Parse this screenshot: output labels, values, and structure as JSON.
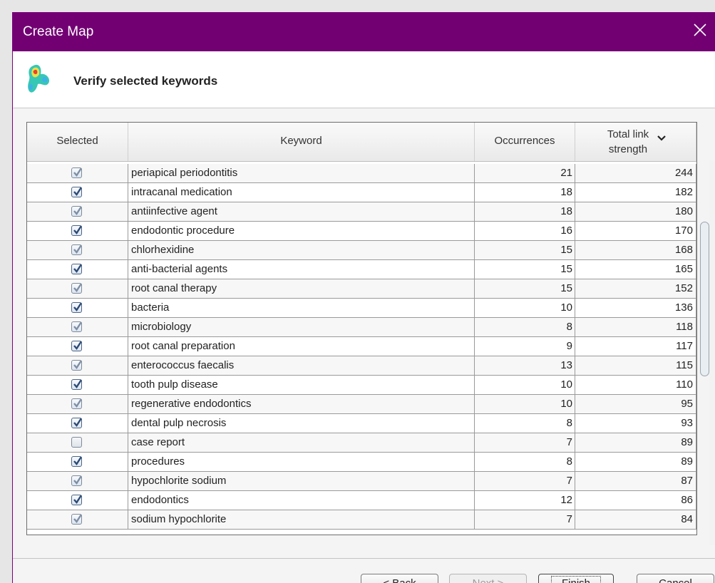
{
  "window": {
    "title": "Create Map"
  },
  "header": {
    "heading": "Verify selected keywords"
  },
  "table": {
    "columns": [
      "Selected",
      "Keyword",
      "Occurrences",
      "Total link strength"
    ],
    "rows": [
      {
        "selected": true,
        "keyword": "periapical periodontitis",
        "occurrences": "21",
        "strength": "244"
      },
      {
        "selected": true,
        "keyword": "intracanal medication",
        "occurrences": "18",
        "strength": "182"
      },
      {
        "selected": true,
        "keyword": "antiinfective agent",
        "occurrences": "18",
        "strength": "180"
      },
      {
        "selected": true,
        "keyword": "endodontic procedure",
        "occurrences": "16",
        "strength": "170"
      },
      {
        "selected": true,
        "keyword": "chlorhexidine",
        "occurrences": "15",
        "strength": "168"
      },
      {
        "selected": true,
        "keyword": "anti-bacterial agents",
        "occurrences": "15",
        "strength": "165"
      },
      {
        "selected": true,
        "keyword": "root canal therapy",
        "occurrences": "15",
        "strength": "152"
      },
      {
        "selected": true,
        "keyword": "bacteria",
        "occurrences": "10",
        "strength": "136"
      },
      {
        "selected": true,
        "keyword": "microbiology",
        "occurrences": "8",
        "strength": "118"
      },
      {
        "selected": true,
        "keyword": "root canal preparation",
        "occurrences": "9",
        "strength": "117"
      },
      {
        "selected": true,
        "keyword": "enterococcus faecalis",
        "occurrences": "13",
        "strength": "115"
      },
      {
        "selected": true,
        "keyword": "tooth pulp disease",
        "occurrences": "10",
        "strength": "110"
      },
      {
        "selected": true,
        "keyword": "regenerative endodontics",
        "occurrences": "10",
        "strength": "95"
      },
      {
        "selected": true,
        "keyword": "dental pulp necrosis",
        "occurrences": "8",
        "strength": "93"
      },
      {
        "selected": false,
        "keyword": "case report",
        "occurrences": "7",
        "strength": "89"
      },
      {
        "selected": true,
        "keyword": "procedures",
        "occurrences": "8",
        "strength": "89"
      },
      {
        "selected": true,
        "keyword": "hypochlorite sodium",
        "occurrences": "7",
        "strength": "87"
      },
      {
        "selected": true,
        "keyword": "endodontics",
        "occurrences": "12",
        "strength": "86"
      },
      {
        "selected": true,
        "keyword": "sodium hypochlorite",
        "occurrences": "7",
        "strength": "84"
      }
    ]
  },
  "buttons": {
    "back": "< Back",
    "next": "Next >",
    "finish": "Finish",
    "cancel": "Cancel"
  },
  "colors": {
    "titlebar": "#720073"
  },
  "icons": {
    "close": "close-icon",
    "logo": "vosviewer-logo-icon",
    "sort": "sort-descending-icon",
    "check": "checkmark-icon"
  }
}
